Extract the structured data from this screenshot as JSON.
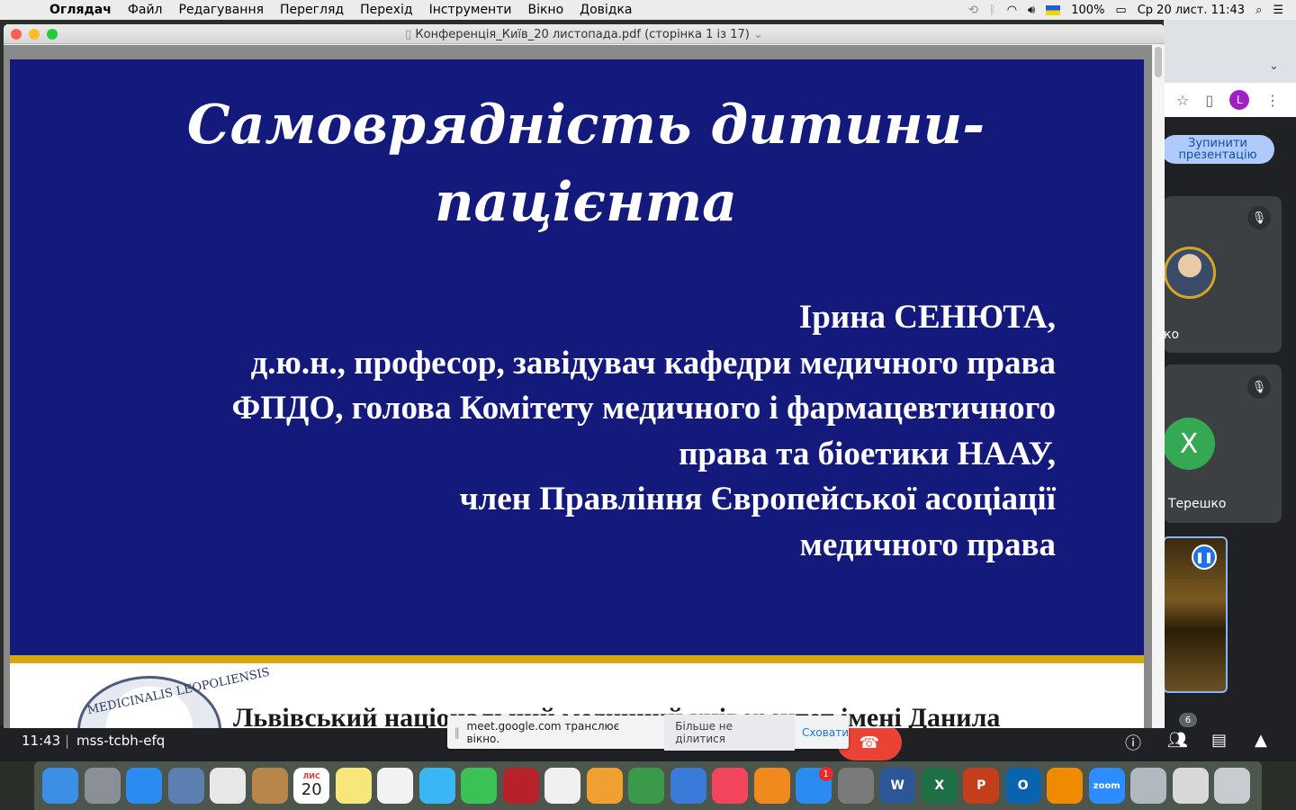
{
  "menubar": {
    "app_name": "Оглядач",
    "items": [
      "Файл",
      "Редагування",
      "Перегляд",
      "Перехід",
      "Інструменти",
      "Вікно",
      "Довідка"
    ],
    "battery": "100%",
    "datetime": "Ср 20 лист.  11:43"
  },
  "window": {
    "title": "Конференція_Київ_20 листопада.pdf (сторінка 1 із 17)"
  },
  "slide": {
    "title_line1": "Самоврядність дитини-",
    "title_line2": "пацієнта",
    "author_lines": [
      "Ірина СЕНЮТА,",
      "д.ю.н., професор, завідувач кафедри медичного права",
      "ФПДО, голова Комітету медичного і фармацевтичного",
      "права та біоетики НААУ,",
      "член Правління Європейської асоціації",
      "медичного права"
    ],
    "seal_text": "MEDICINALIS LEOPOLIENSIS",
    "university_text": "Львівський національний медичний університет імені Данила"
  },
  "meet": {
    "stop_presentation": "Зупинити презентацію",
    "participant1_name": "ко",
    "participant2_initial": "X",
    "participant2_name": "Терешко",
    "participants_count": "6",
    "time": "11:43",
    "meeting_code": "mss-tcbh-efq",
    "profile_initial": "L"
  },
  "share_bar": {
    "message": "meet.google.com транслює вікно.",
    "stop_label": "Більше не ділитися",
    "hide_label": "Сховати"
  },
  "dock": {
    "calendar_month": "ЛИС",
    "calendar_day": "20",
    "appstore_badge": "1",
    "zoom_label": "zoom",
    "icons": [
      {
        "name": "finder-icon",
        "color": "#3b8fe6"
      },
      {
        "name": "launchpad-icon",
        "color": "#8a8f98"
      },
      {
        "name": "safari-icon",
        "color": "#2a8cf0"
      },
      {
        "name": "preview-app-icon",
        "color": "#5a7fb0"
      },
      {
        "name": "chrome-icon",
        "color": "#e8e8e8"
      },
      {
        "name": "contacts-icon",
        "color": "#b8864a"
      },
      {
        "name": "calendar-icon",
        "color": "#ffffff"
      },
      {
        "name": "notes-icon",
        "color": "#f7e67a"
      },
      {
        "name": "reminders-icon",
        "color": "#f2f2f2"
      },
      {
        "name": "messages-icon",
        "color": "#39b7f5"
      },
      {
        "name": "facetime-icon",
        "color": "#3ac255"
      },
      {
        "name": "photo-booth-icon",
        "color": "#b8202a"
      },
      {
        "name": "photos-icon",
        "color": "#f0f0f0"
      },
      {
        "name": "pages-icon",
        "color": "#f0a030"
      },
      {
        "name": "numbers-icon",
        "color": "#3a9a4a"
      },
      {
        "name": "keynote-icon",
        "color": "#3a7ad8"
      },
      {
        "name": "music-icon",
        "color": "#f3455c"
      },
      {
        "name": "books-icon",
        "color": "#f08a1e"
      },
      {
        "name": "app-store-icon",
        "color": "#2a8cf0"
      },
      {
        "name": "system-preferences-icon",
        "color": "#7a7a7a"
      },
      {
        "name": "word-icon",
        "color": "#2b5797"
      },
      {
        "name": "excel-icon",
        "color": "#1d7044"
      },
      {
        "name": "powerpoint-icon",
        "color": "#c43e1c"
      },
      {
        "name": "outlook-icon",
        "color": "#0a64ad"
      },
      {
        "name": "vlc-icon",
        "color": "#f08a00"
      },
      {
        "name": "zoom-icon",
        "color": "#2d8cff"
      },
      {
        "name": "image-capture-icon",
        "color": "#b0b8c0"
      },
      {
        "name": "downloads-icon",
        "color": "#d8d8d8"
      },
      {
        "name": "trash-icon",
        "color": "#c8ccd0"
      }
    ]
  }
}
